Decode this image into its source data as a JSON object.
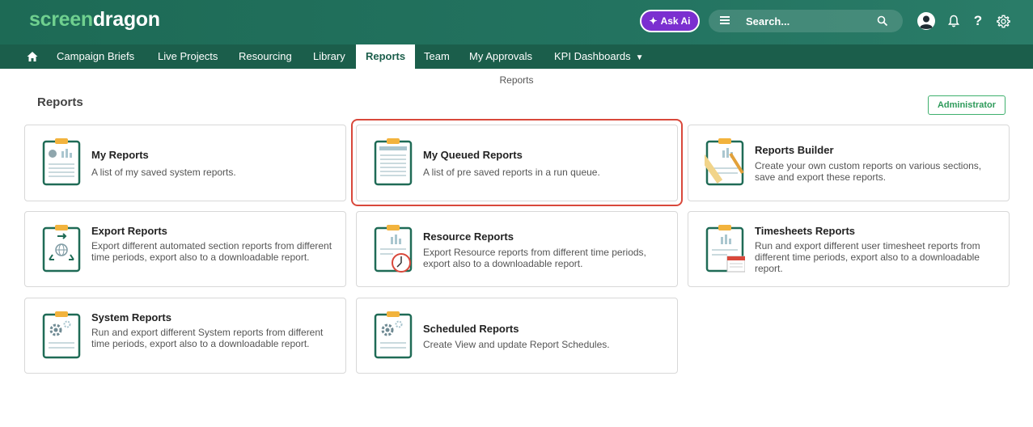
{
  "header": {
    "logo_part1": "screen",
    "logo_part2": "dragon",
    "ask_ai_label": "Ask Ai",
    "search_placeholder": "Search..."
  },
  "nav": {
    "items": [
      {
        "label": "Campaign Briefs"
      },
      {
        "label": "Live Projects"
      },
      {
        "label": "Resourcing"
      },
      {
        "label": "Library"
      },
      {
        "label": "Reports"
      },
      {
        "label": "Team"
      },
      {
        "label": "My Approvals"
      },
      {
        "label": "KPI Dashboards"
      }
    ],
    "active": "Reports"
  },
  "breadcrumb": "Reports",
  "page": {
    "title": "Reports",
    "admin_button": "Administrator"
  },
  "cards": [
    {
      "title": "My Reports",
      "desc": "A list of my saved system reports."
    },
    {
      "title": "My Queued Reports",
      "desc": "A list of pre saved reports in a run queue."
    },
    {
      "title": "Reports Builder",
      "desc": "Create your own custom reports on various sections, save and export these reports."
    },
    {
      "title": "Export Reports",
      "desc": "Export different automated section reports from different time periods, export also to a downloadable report."
    },
    {
      "title": "Resource Reports",
      "desc": "Export Resource reports from different time periods, export also to a downloadable report."
    },
    {
      "title": "Timesheets Reports",
      "desc": "Run and export different user timesheet reports from different time periods, export also to a downloadable report."
    },
    {
      "title": "System Reports",
      "desc": "Run and export different System reports from different time periods, export also to a downloadable report."
    },
    {
      "title": "Scheduled Reports",
      "desc": "Create View and update Report Schedules."
    }
  ],
  "colors": {
    "brand_green": "#1f6b56",
    "nav_green": "#1b5e4b",
    "ask_ai_purple": "#7b2fd0",
    "highlight_red": "#d9483b",
    "clipboard_clip": "#f2b33d"
  }
}
